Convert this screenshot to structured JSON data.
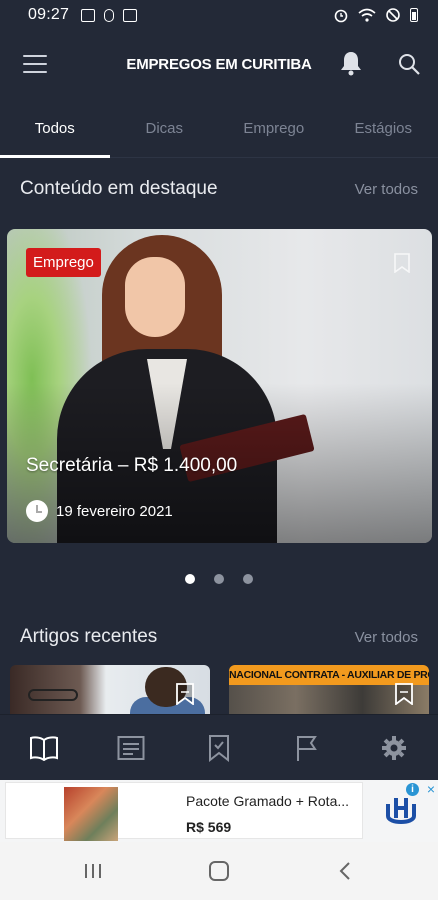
{
  "status_bar": {
    "time": "09:27"
  },
  "app_bar": {
    "title": "EMPREGOS EM CURITIBA"
  },
  "tabs": [
    {
      "label": "Todos"
    },
    {
      "label": "Dicas"
    },
    {
      "label": "Emprego"
    },
    {
      "label": "Estágios"
    }
  ],
  "featured_section": {
    "title": "Conteúdo em destaque",
    "see_all": "Ver todos",
    "card": {
      "badge": "Emprego",
      "title": "Secretária – R$ 1.400,00",
      "date": "19 fevereiro 2021"
    },
    "carousel": {
      "count": 3,
      "active_index": 0
    }
  },
  "recent_section": {
    "title": "Artigos recentes",
    "see_all": "Ver todos",
    "thumb2_banner": "NACIONAL CONTRATA - AUXILIAR DE PROD"
  },
  "ad": {
    "title": "Pacote Gramado + Rota...",
    "price": "R$ 569",
    "info_icon": "i",
    "close_icon": "×"
  },
  "colors": {
    "background": "#232937",
    "badge": "#d31b1b",
    "tab_indicator": "#ffffff",
    "ad_accent": "#2a95d4"
  }
}
